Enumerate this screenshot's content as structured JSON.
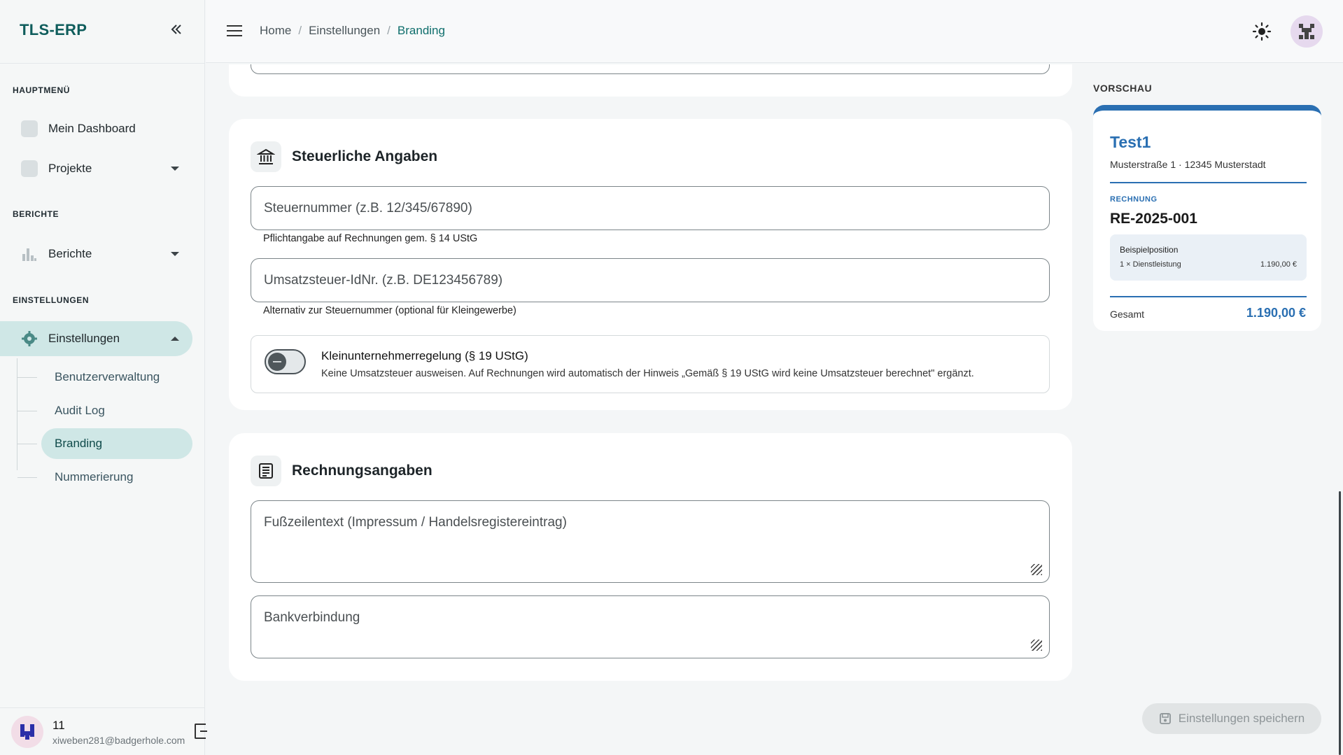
{
  "app": {
    "brand": "TLS-ERP"
  },
  "sidebar": {
    "sections": {
      "main": "HAUPTMENÜ",
      "reports": "BERICHTE",
      "settings": "EINSTELLUNGEN"
    },
    "items": [
      {
        "label": "Mein Dashboard",
        "icon": "dashboard-icon"
      },
      {
        "label": "Projekte",
        "icon": "folder-icon"
      },
      {
        "label": "Berichte",
        "icon": "bar-chart-icon"
      },
      {
        "label": "Einstellungen",
        "icon": "gear-icon"
      }
    ],
    "subitems": [
      {
        "label": "Benutzerverwaltung"
      },
      {
        "label": "Audit Log"
      },
      {
        "label": "Branding"
      },
      {
        "label": "Nummerierung"
      }
    ]
  },
  "user": {
    "name": "11",
    "email": "xiweben281@badgerhole.com"
  },
  "breadcrumb": {
    "home": "Home",
    "settings": "Einstellungen",
    "current": "Branding"
  },
  "tax": {
    "title": "Steuerliche Angaben",
    "tax_number_placeholder": "Steuernummer (z.B. 12/345/67890)",
    "tax_number_help": "Pflichtangabe auf Rechnungen gem. § 14 UStG",
    "vat_id_placeholder": "Umsatzsteuer-IdNr. (z.B. DE123456789)",
    "vat_id_help": "Alternativ zur Steuernummer (optional für Kleingewerbe)",
    "small_business_title": "Kleinunternehmerregelung (§ 19 UStG)",
    "small_business_desc": "Keine Umsatzsteuer ausweisen. Auf Rechnungen wird automatisch der Hinweis „Gemäß § 19 UStG wird keine Umsatzsteuer berechnet\" ergänzt.",
    "small_business_enabled": false
  },
  "invoice": {
    "title": "Rechnungsangaben",
    "footer_placeholder": "Fußzeilentext (Impressum / Handelsregistereintrag)",
    "bank_placeholder": "Bankverbindung"
  },
  "preview": {
    "label": "VORSCHAU",
    "company": "Test1",
    "address": "Musterstraße 1 · 12345 Musterstadt",
    "doc_type": "RECHNUNG",
    "doc_number": "RE-2025-001",
    "item_title": "Beispielposition",
    "item_qty": "1 × Dienstleistung",
    "item_price": "1.190,00 €",
    "total_label": "Gesamt",
    "total_value": "1.190,00 €",
    "accent_color": "#2a6fb2"
  },
  "actions": {
    "save": "Einstellungen speichern"
  }
}
